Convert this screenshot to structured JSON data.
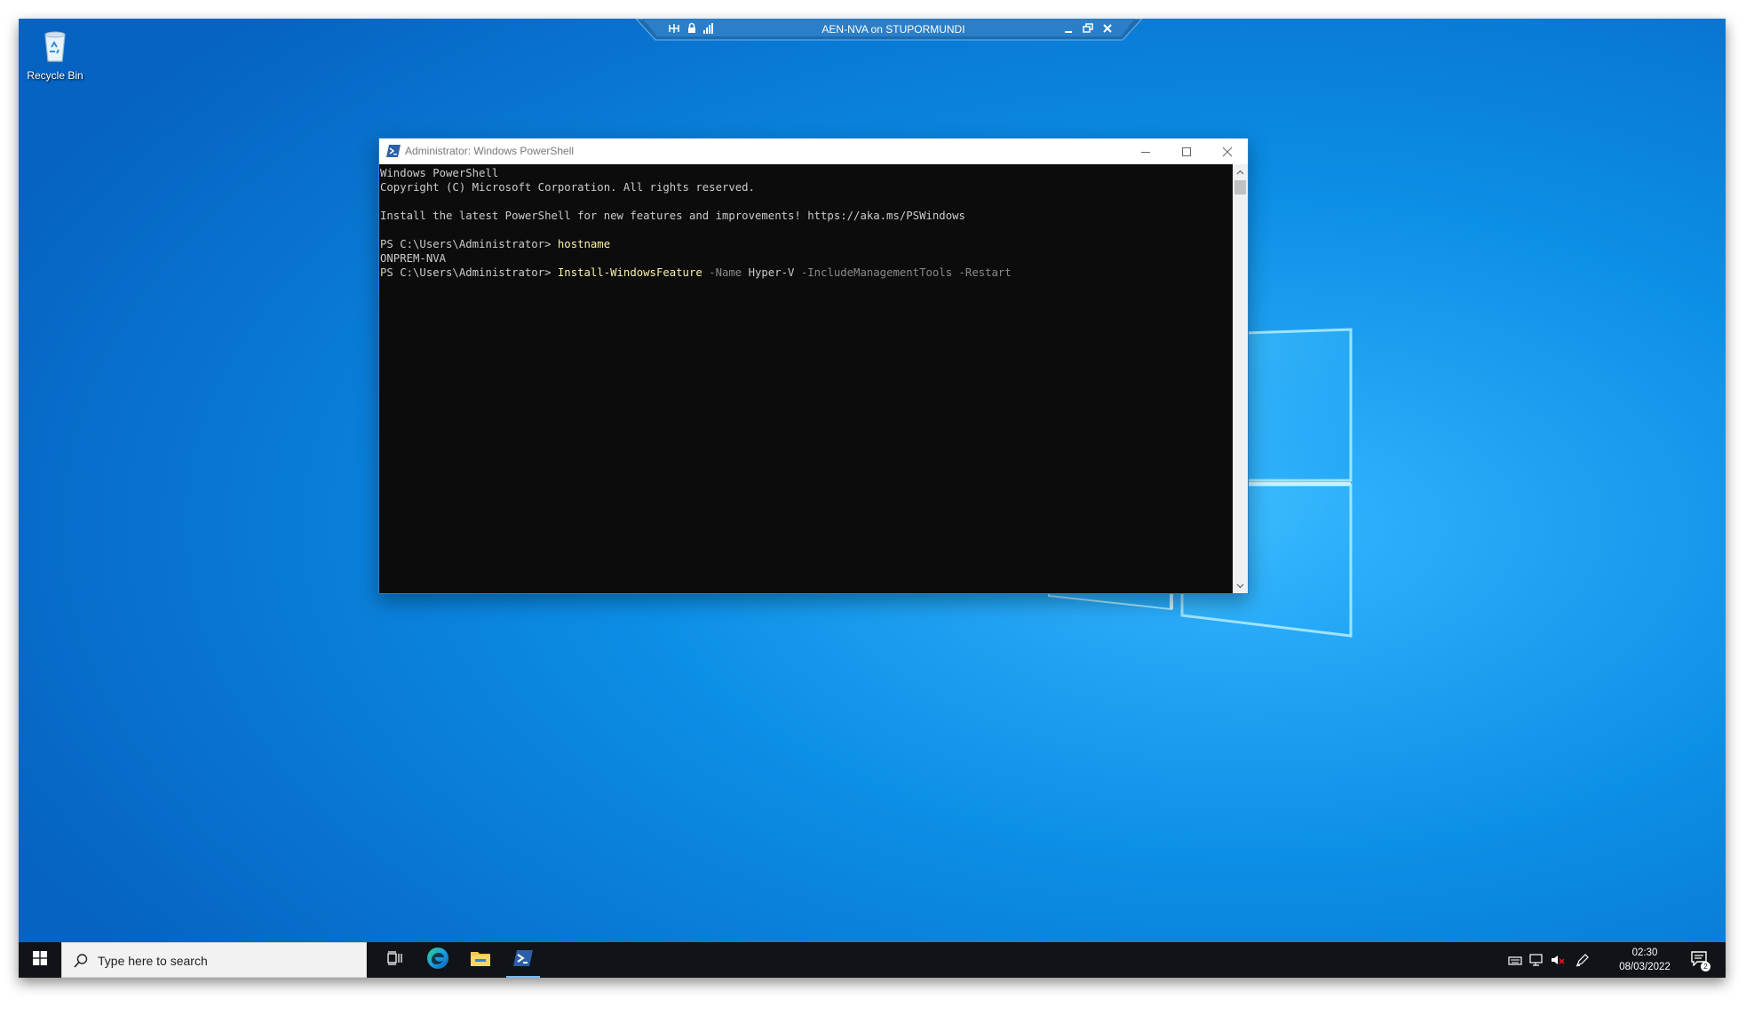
{
  "rdp_bar": {
    "title": "AEN-NVA on STUPORMUNDI",
    "icons": [
      "pin-icon",
      "lock-icon",
      "signal-icon",
      "minimize-icon",
      "restore-icon",
      "close-icon"
    ]
  },
  "desktop": {
    "icons": [
      {
        "label": "Recycle Bin",
        "icon": "recycle-bin-icon"
      }
    ]
  },
  "powershell_window": {
    "title": "Administrator: Windows PowerShell",
    "lines": {
      "header1": "Windows PowerShell",
      "header2": "Copyright (C) Microsoft Corporation. All rights reserved.",
      "install_msg": "Install the latest PowerShell for new features and improvements! https://aka.ms/PSWindows",
      "prompt": "PS C:\\Users\\Administrator> ",
      "cmd1": "hostname",
      "output1": "ONPREM-NVA",
      "cmd2": "Install-WindowsFeature",
      "param_name": " -Name",
      "arg_name": " Hyper-V",
      "param_tools": " -IncludeManagementTools",
      "param_restart": " -Restart"
    },
    "colors": {
      "background": "#0c0c0c",
      "text": "#cccccc",
      "command": "#f9f1a5",
      "parameter": "#8a8a8a"
    }
  },
  "taskbar": {
    "start_icon": "windows-start-icon",
    "search_placeholder": "Type here to search",
    "pinned": [
      "task-view-icon",
      "edge-icon",
      "file-explorer-icon",
      "powershell-icon"
    ],
    "active_app": "powershell",
    "tray": [
      "keyboard-icon",
      "network-icon",
      "volume-muted-icon",
      "pen-icon"
    ],
    "clock": {
      "time": "02:30",
      "date": "08/03/2022"
    },
    "notification_count": "2"
  }
}
